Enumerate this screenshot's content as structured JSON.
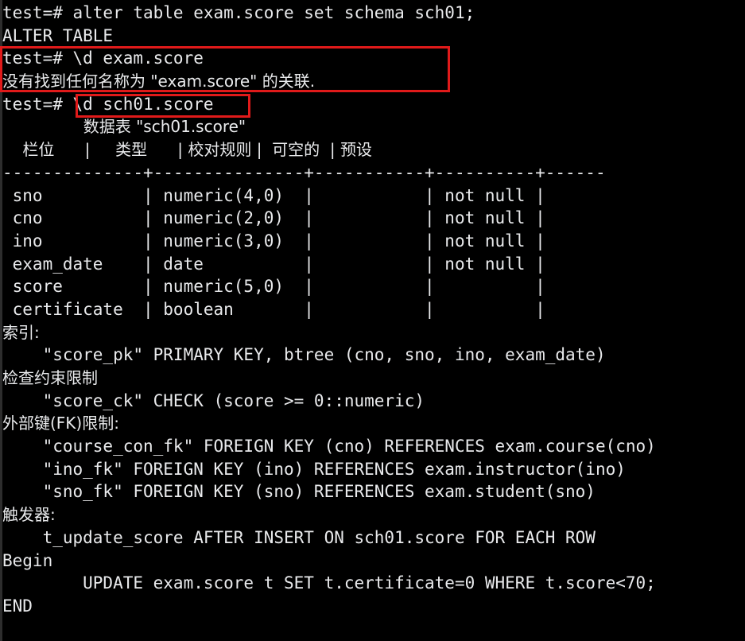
{
  "terminal": {
    "background_color": "#000000",
    "text_color": "#e9eaec",
    "annotation_color": "#e01a1a",
    "prompt": "test=#"
  },
  "lines": [
    {
      "id": "cmd_alter",
      "text": "test=# alter table exam.score set schema sch01;"
    },
    {
      "id": "result_alter",
      "text": "ALTER TABLE"
    },
    {
      "id": "cmd_d_exam_score",
      "text": "test=# \\d exam.score"
    },
    {
      "id": "error_not_found",
      "text": "没有找到任何名称为 \"exam.score\" 的关联."
    },
    {
      "id": "cmd_d_sch01_score",
      "text": "test=# \\d sch01.score"
    },
    {
      "id": "table_title",
      "text": "                数据表 \"sch01.score\""
    },
    {
      "id": "table_header",
      "text": "    栏位      |     类型      | 校对规则 |  可空的  | 预设"
    },
    {
      "id": "table_separator",
      "text": "--------------+---------------+-----------+----------+------"
    },
    {
      "id": "row_sno",
      "text": " sno          | numeric(4,0)  |           | not null |"
    },
    {
      "id": "row_cno",
      "text": " cno          | numeric(2,0)  |           | not null |"
    },
    {
      "id": "row_ino",
      "text": " ino          | numeric(3,0)  |           | not null |"
    },
    {
      "id": "row_exam_date",
      "text": " exam_date    | date          |           | not null |"
    },
    {
      "id": "row_score",
      "text": " score        | numeric(5,0)  |           |          |"
    },
    {
      "id": "row_certificate",
      "text": " certificate  | boolean       |           |          |"
    },
    {
      "id": "label_indexes",
      "text": "索引:"
    },
    {
      "id": "index_score_pk",
      "text": "    \"score_pk\" PRIMARY KEY, btree (cno, sno, ino, exam_date)"
    },
    {
      "id": "label_check",
      "text": "检查约束限制"
    },
    {
      "id": "check_score_ck",
      "text": "    \"score_ck\" CHECK (score >= 0::numeric)"
    },
    {
      "id": "label_fk",
      "text": "外部键(FK)限制:"
    },
    {
      "id": "fk_course_con_fk",
      "text": "    \"course_con_fk\" FOREIGN KEY (cno) REFERENCES exam.course(cno)"
    },
    {
      "id": "fk_ino_fk",
      "text": "    \"ino_fk\" FOREIGN KEY (ino) REFERENCES exam.instructor(ino)"
    },
    {
      "id": "fk_sno_fk",
      "text": "    \"sno_fk\" FOREIGN KEY (sno) REFERENCES exam.student(sno)"
    },
    {
      "id": "label_triggers",
      "text": "触发器:"
    },
    {
      "id": "trigger_decl",
      "text": "    t_update_score AFTER INSERT ON sch01.score FOR EACH ROW"
    },
    {
      "id": "trigger_begin",
      "text": "Begin"
    },
    {
      "id": "trigger_update",
      "text": "        UPDATE exam.score t SET t.certificate=0 WHERE t.score<70;"
    },
    {
      "id": "trigger_end",
      "text": "END"
    }
  ],
  "table_meta": {
    "title": "数据表 \"sch01.score\"",
    "columns": [
      "栏位",
      "类型",
      "校对规则",
      "可空的",
      "预设"
    ],
    "rows": [
      {
        "column": "sno",
        "type": "numeric(4,0)",
        "collation": "",
        "nullable": "not null",
        "default": ""
      },
      {
        "column": "cno",
        "type": "numeric(2,0)",
        "collation": "",
        "nullable": "not null",
        "default": ""
      },
      {
        "column": "ino",
        "type": "numeric(3,0)",
        "collation": "",
        "nullable": "not null",
        "default": ""
      },
      {
        "column": "exam_date",
        "type": "date",
        "collation": "",
        "nullable": "not null",
        "default": ""
      },
      {
        "column": "score",
        "type": "numeric(5,0)",
        "collation": "",
        "nullable": "",
        "default": ""
      },
      {
        "column": "certificate",
        "type": "boolean",
        "collation": "",
        "nullable": "",
        "default": ""
      }
    ]
  },
  "annotations": [
    {
      "id": "annot-exam-score",
      "label": "highlight-failed-exam-score-lookup"
    },
    {
      "id": "annot-sch01-score",
      "label": "highlight-sch01-score-command"
    }
  ]
}
